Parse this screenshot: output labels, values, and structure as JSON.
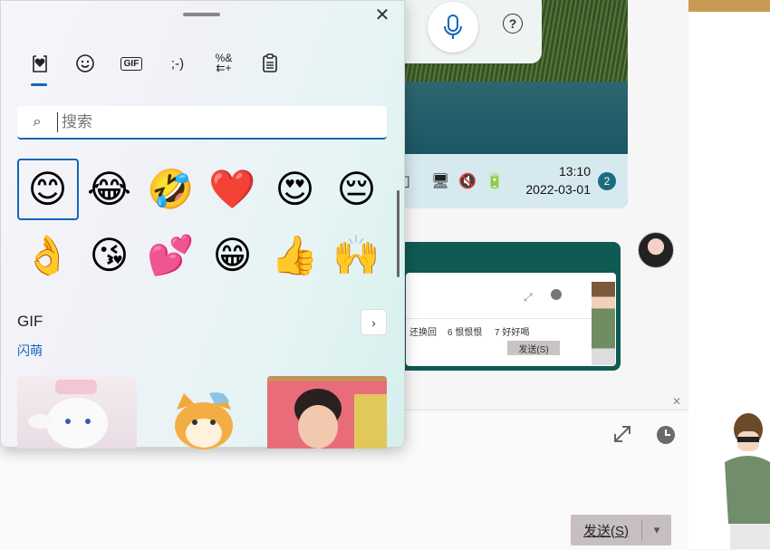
{
  "emoji_panel": {
    "close_symbol": "✕",
    "tabs": [
      {
        "name": "tab-favorites",
        "icon": "heart-clipboard-icon",
        "glyph": "♥"
      },
      {
        "name": "tab-emoji",
        "icon": "smiley-icon",
        "glyph": "☺"
      },
      {
        "name": "tab-gif",
        "icon": "gif-icon",
        "glyph": "GIF"
      },
      {
        "name": "tab-kaomoji",
        "icon": "kaomoji-icon",
        "glyph": ";-)"
      },
      {
        "name": "tab-symbols",
        "icon": "symbols-icon",
        "glyph": "%&"
      },
      {
        "name": "tab-clipboard",
        "icon": "clipboard-icon",
        "glyph": "📋"
      }
    ],
    "search": {
      "placeholder": "搜索",
      "value": "",
      "icon": "⌕"
    },
    "emojis_row1": [
      "😊",
      "😂",
      "🤣",
      "❤️",
      "😍",
      "😔"
    ],
    "emojis_row2": [
      "👌",
      "😘",
      "💕",
      "😁",
      "👍",
      "🙌"
    ],
    "gif_section": {
      "title": "GIF",
      "subtitle": "闪萌",
      "more_symbol": "›"
    }
  },
  "background": {
    "tray": {
      "time": "13:10",
      "date": "2022-03-01",
      "notifications": "2"
    },
    "help_symbol": "?",
    "mini_chat": {
      "items": [
        "还换回",
        "6 恨恨恨",
        "7 好好喝"
      ],
      "send": "发送(S)"
    },
    "send_button": {
      "label": "发送(S)",
      "chevron": "▾"
    }
  },
  "colors": {
    "accent": "#1466b8",
    "bubble": "#0f5a52",
    "badge": "#1b6c7e"
  }
}
